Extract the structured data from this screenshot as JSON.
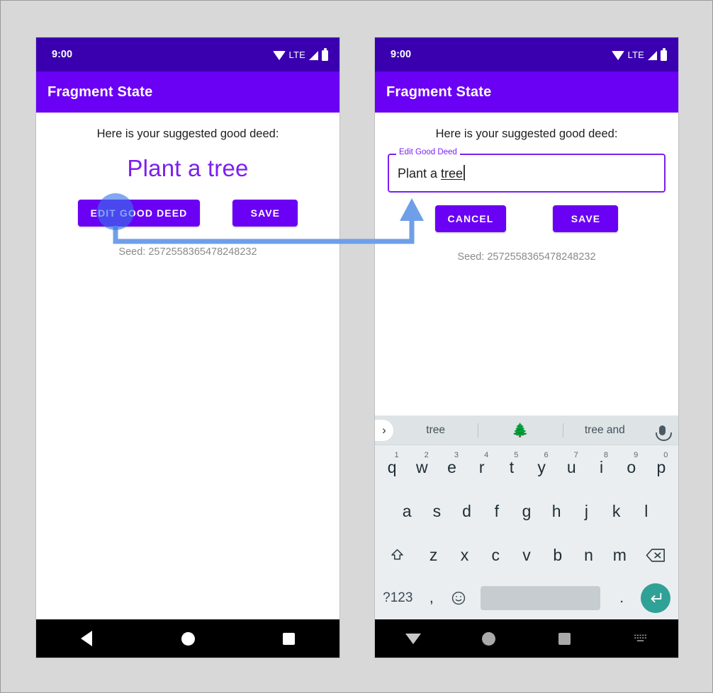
{
  "canvas": {
    "background": "#d8d8d8",
    "border_color": "#9a9a9a"
  },
  "theme": {
    "status_bar_color": "#3a00b0",
    "app_bar_color": "#6a00f4",
    "primary_color": "#6a00f4",
    "accent_text_color": "#7b1ff0",
    "annotation_color": "#6f9fe8",
    "keyboard_background": "#eaeef0",
    "keyboard_suggest_background": "#dee3e6",
    "enter_key_color": "#30a197"
  },
  "status_bar": {
    "time": "9:00",
    "network_label": "LTE",
    "icons": [
      "wifi-icon",
      "signal-icon",
      "battery-icon"
    ]
  },
  "app_bar": {
    "title": "Fragment State"
  },
  "left_phone": {
    "name": "before-state",
    "suggest_label": "Here is your suggested good deed:",
    "deed_text": "Plant a tree",
    "buttons": [
      {
        "name": "edit-good-deed-button",
        "label": "EDIT GOOD DEED"
      },
      {
        "name": "save-button",
        "label": "SAVE"
      }
    ],
    "seed_text": "Seed: 2572558365478248232"
  },
  "right_phone": {
    "name": "after-state",
    "suggest_label": "Here is your suggested good deed:",
    "text_field": {
      "legend": "Edit Good Deed",
      "value_plain": "Plant a ",
      "value_composing": "tree",
      "full_value": "Plant a tree"
    },
    "buttons": [
      {
        "name": "cancel-button",
        "label": "CANCEL"
      },
      {
        "name": "save-button",
        "label": "SAVE"
      }
    ],
    "seed_text": "Seed: 2572558365478248232"
  },
  "keyboard": {
    "suggestions": [
      {
        "name": "suggestion-tree",
        "label": "tree"
      },
      {
        "name": "suggestion-tree-emoji",
        "label": "🌲"
      },
      {
        "name": "suggestion-tree-and",
        "label": "tree and"
      }
    ],
    "expand_icon": "chevron-right-icon",
    "mic_icon": "microphone-icon",
    "row1": [
      {
        "key": "q",
        "sup": "1"
      },
      {
        "key": "w",
        "sup": "2"
      },
      {
        "key": "e",
        "sup": "3"
      },
      {
        "key": "r",
        "sup": "4"
      },
      {
        "key": "t",
        "sup": "5"
      },
      {
        "key": "y",
        "sup": "6"
      },
      {
        "key": "u",
        "sup": "7"
      },
      {
        "key": "i",
        "sup": "8"
      },
      {
        "key": "o",
        "sup": "9"
      },
      {
        "key": "p",
        "sup": "0"
      }
    ],
    "row2": [
      "a",
      "s",
      "d",
      "f",
      "g",
      "h",
      "j",
      "k",
      "l"
    ],
    "row3_letters": [
      "z",
      "x",
      "c",
      "v",
      "b",
      "n",
      "m"
    ],
    "shift_icon": "shift-icon",
    "backspace_icon": "backspace-icon",
    "row4": {
      "symbols_label": "?123",
      "comma": ",",
      "emoji_icon": "emoji-icon",
      "space_label": "",
      "period": ".",
      "enter_icon": "enter-icon"
    }
  },
  "nav_bar": {
    "left": [
      "back-icon",
      "home-icon",
      "recents-icon"
    ],
    "right": [
      "back-down-icon",
      "home-icon",
      "recents-icon",
      "keyboard-icon"
    ]
  },
  "annotation": {
    "tap_target": "edit-good-deed-button",
    "arrow_target": "edit-good-deed-text-field"
  }
}
